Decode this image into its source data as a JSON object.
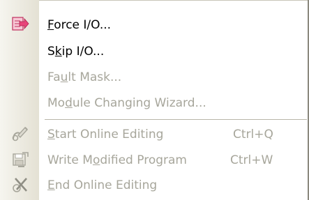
{
  "menu": {
    "items": [
      {
        "label_pre": "",
        "label_key": "F",
        "label_post": "orce I/O...",
        "shortcut": "",
        "enabled": true,
        "icon": "force-io-icon"
      },
      {
        "label_pre": "S",
        "label_key": "k",
        "label_post": "ip I/O...",
        "shortcut": "",
        "enabled": true,
        "icon": ""
      },
      {
        "label_pre": "Fa",
        "label_key": "u",
        "label_post": "lt Mask...",
        "shortcut": "",
        "enabled": false,
        "icon": ""
      },
      {
        "label_pre": "Mo",
        "label_key": "d",
        "label_post": "ule Changing Wizard...",
        "shortcut": "",
        "enabled": false,
        "icon": ""
      },
      {
        "label_pre": "",
        "label_key": "S",
        "label_post": "tart Online Editing",
        "shortcut": "Ctrl+Q",
        "enabled": false,
        "icon": "start-online-editing-icon"
      },
      {
        "label_pre": "Write M",
        "label_key": "o",
        "label_post": "dified Program",
        "shortcut": "Ctrl+W",
        "enabled": false,
        "icon": "write-modified-program-icon"
      },
      {
        "label_pre": "",
        "label_key": "E",
        "label_post": "nd Online Editing",
        "shortcut": "",
        "enabled": false,
        "icon": "end-online-editing-icon"
      }
    ],
    "colors": {
      "text_enabled": "#000000",
      "text_disabled": "#a7a69b",
      "gutter_light": "#f6f5ef",
      "gutter_dark": "#e4e1d4",
      "force_icon_pink": "#e8457a"
    }
  }
}
